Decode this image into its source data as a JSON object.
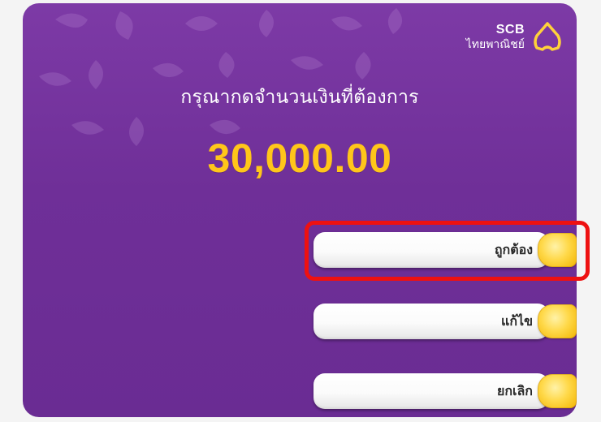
{
  "brand": {
    "name": "SCB",
    "name_thai": "ไทยพาณิชย์",
    "logo_icon": "scb-bell-icon"
  },
  "prompt": "กรุณากดจำนวนเงินที่ต้องการ",
  "amount": "30,000.00",
  "options": [
    {
      "label": "ถูกต้อง",
      "highlighted": true
    },
    {
      "label": "แก้ไข",
      "highlighted": false
    },
    {
      "label": "ยกเลิก",
      "highlighted": false
    }
  ],
  "colors": {
    "background": "#6f2f98",
    "amount": "#ffc61a",
    "key": "#ffd94a",
    "highlight": "#ee1111"
  }
}
